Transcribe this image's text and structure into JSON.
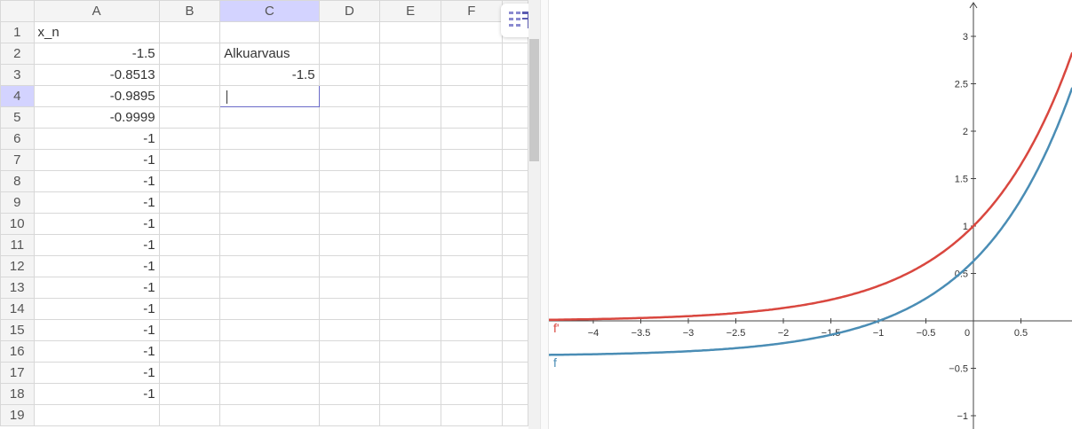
{
  "spreadsheet": {
    "columns": [
      "A",
      "B",
      "C",
      "D",
      "E",
      "F"
    ],
    "selected_column": "C",
    "selected_row": 4,
    "rows": [
      {
        "num": "1",
        "a": "x_n",
        "c": ""
      },
      {
        "num": "2",
        "a": "-1.5",
        "c": "Alkuarvaus"
      },
      {
        "num": "3",
        "a": "-0.8513",
        "c": "-1.5"
      },
      {
        "num": "4",
        "a": "-0.9895",
        "c": ""
      },
      {
        "num": "5",
        "a": "-0.9999",
        "c": ""
      },
      {
        "num": "6",
        "a": "-1",
        "c": ""
      },
      {
        "num": "7",
        "a": "-1",
        "c": ""
      },
      {
        "num": "8",
        "a": "-1",
        "c": ""
      },
      {
        "num": "9",
        "a": "-1",
        "c": ""
      },
      {
        "num": "10",
        "a": "-1",
        "c": ""
      },
      {
        "num": "11",
        "a": "-1",
        "c": ""
      },
      {
        "num": "12",
        "a": "-1",
        "c": ""
      },
      {
        "num": "13",
        "a": "-1",
        "c": ""
      },
      {
        "num": "14",
        "a": "-1",
        "c": ""
      },
      {
        "num": "15",
        "a": "-1",
        "c": ""
      },
      {
        "num": "16",
        "a": "-1",
        "c": ""
      },
      {
        "num": "17",
        "a": "-1",
        "c": ""
      },
      {
        "num": "18",
        "a": "-1",
        "c": ""
      },
      {
        "num": "19",
        "a": "",
        "c": ""
      }
    ],
    "toolbar_icon": "spreadsheet-style-bar-icon"
  },
  "graphics": {
    "x_ticks": [
      "−4",
      "−3.5",
      "−3",
      "−2.5",
      "−2",
      "−1.5",
      "−1",
      "−0.5",
      "0",
      "0.5"
    ],
    "y_ticks": [
      "3",
      "2.5",
      "2",
      "1.5",
      "1",
      "0.5",
      "−0.5",
      "−1"
    ],
    "curves": [
      {
        "label": "f'",
        "color": "#d9473f"
      },
      {
        "label": "f",
        "color": "#4a8db5"
      }
    ]
  }
}
